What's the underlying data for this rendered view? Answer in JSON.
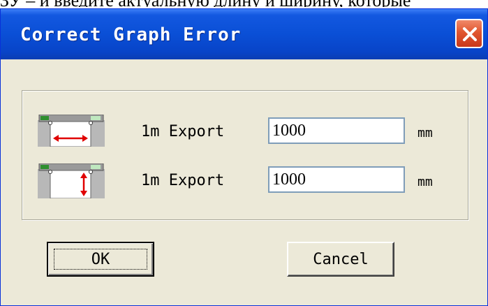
{
  "background_text": "ЗУ – и введите актуальную длину и ширину, которые",
  "dialog": {
    "title": "Correct Graph Error",
    "close_icon": "close-icon"
  },
  "rows": [
    {
      "icon": "horizontal-dimension-icon",
      "label": "1m Export",
      "value": "1000",
      "unit": "mm"
    },
    {
      "icon": "vertical-dimension-icon",
      "label": "1m Export",
      "value": "1000",
      "unit": "mm"
    }
  ],
  "buttons": {
    "ok_label": "OK",
    "cancel_label": "Cancel"
  },
  "colors": {
    "titlebar": "#0a4fd6",
    "dialog_bg": "#ece9d8",
    "close_button": "#e1562f",
    "arrow": "#e00000"
  }
}
